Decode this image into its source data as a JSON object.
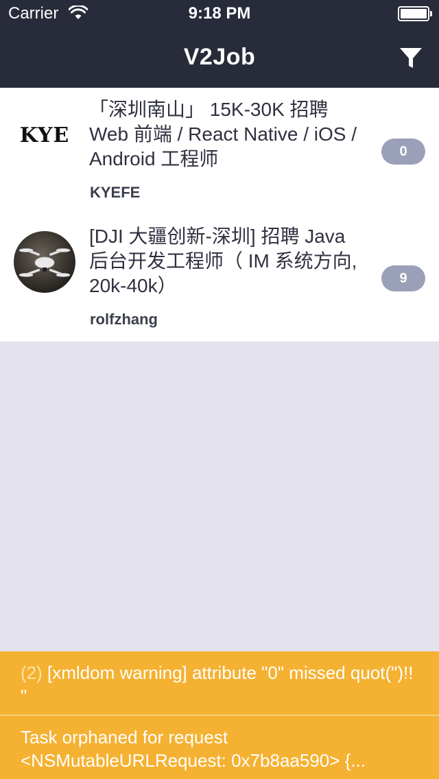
{
  "status_bar": {
    "carrier": "Carrier",
    "time": "9:18 PM"
  },
  "nav": {
    "title": "V2Job",
    "filter_icon": "filter-icon"
  },
  "jobs": [
    {
      "title": "「深圳南山」 15K-30K 招聘 Web 前端 / React Native / iOS / Android 工程师",
      "author": "KYEFE",
      "replies": "0",
      "avatar_text": "KYE"
    },
    {
      "title": "[DJI 大疆创新-深圳] 招聘 Java 后台开发工程师（ IM 系统方向, 20k-40k）",
      "author": "rolfzhang",
      "replies": "9",
      "avatar_text": ""
    }
  ],
  "warnings": [
    {
      "count": "(2)",
      "message": "[xmldom warning] attribute \"0\" missed quot(\")!! \""
    },
    {
      "line1": "Task orphaned for request",
      "line2": "<NSMutableURLRequest: 0x7b8aa590> {..."
    }
  ],
  "colors": {
    "nav_bg": "#282b39",
    "list_bg": "#ffffff",
    "page_bg": "#e3e2ed",
    "badge_bg": "#9aa0b8",
    "warning_bg": "#f5b131"
  }
}
